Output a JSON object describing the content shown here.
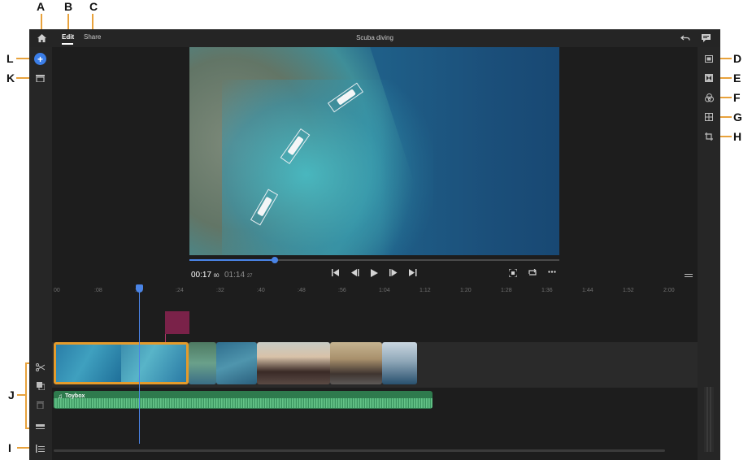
{
  "callouts": {
    "a": "A",
    "b": "B",
    "c": "C",
    "d": "D",
    "e": "E",
    "f": "F",
    "g": "G",
    "h": "H",
    "i": "I",
    "j": "J",
    "k": "K",
    "l": "L"
  },
  "header": {
    "tabs": [
      {
        "label": "Edit",
        "active": true
      },
      {
        "label": "Share",
        "active": false
      }
    ],
    "project_title": "Scuba diving"
  },
  "player": {
    "current_time": "00:17",
    "current_frames": "00",
    "total_time": "01:14",
    "total_frames": "27",
    "progress_fraction": 0.23
  },
  "timeline": {
    "ruler": [
      "00",
      ":08",
      ":16",
      ":24",
      ":32",
      ":40",
      ":48",
      ":56",
      "1:04",
      "1:12",
      "1:20",
      "1:28",
      "1:36",
      "1:44",
      "1:52",
      "2:00"
    ],
    "audio_clip_label": "Toybox"
  },
  "colors": {
    "accent": "#4a84e6",
    "selection": "#e49b2c",
    "audio": "#2e7a4d",
    "marker": "#7a2249",
    "callout_line": "#e8a23c"
  },
  "icons": {
    "home": "home-icon",
    "undo": "undo-icon",
    "feedback": "feedback-icon",
    "add_media": "add-media-icon",
    "content_panel": "content-panel-icon",
    "split": "scissors-icon",
    "duplicate": "duplicate-icon",
    "delete": "trash-icon",
    "track_options": "track-options-icon",
    "track_list": "track-list-icon",
    "titles": "titles-icon",
    "transitions": "transitions-icon",
    "color": "color-icon",
    "grid": "grid-icon",
    "crop": "crop-icon"
  }
}
